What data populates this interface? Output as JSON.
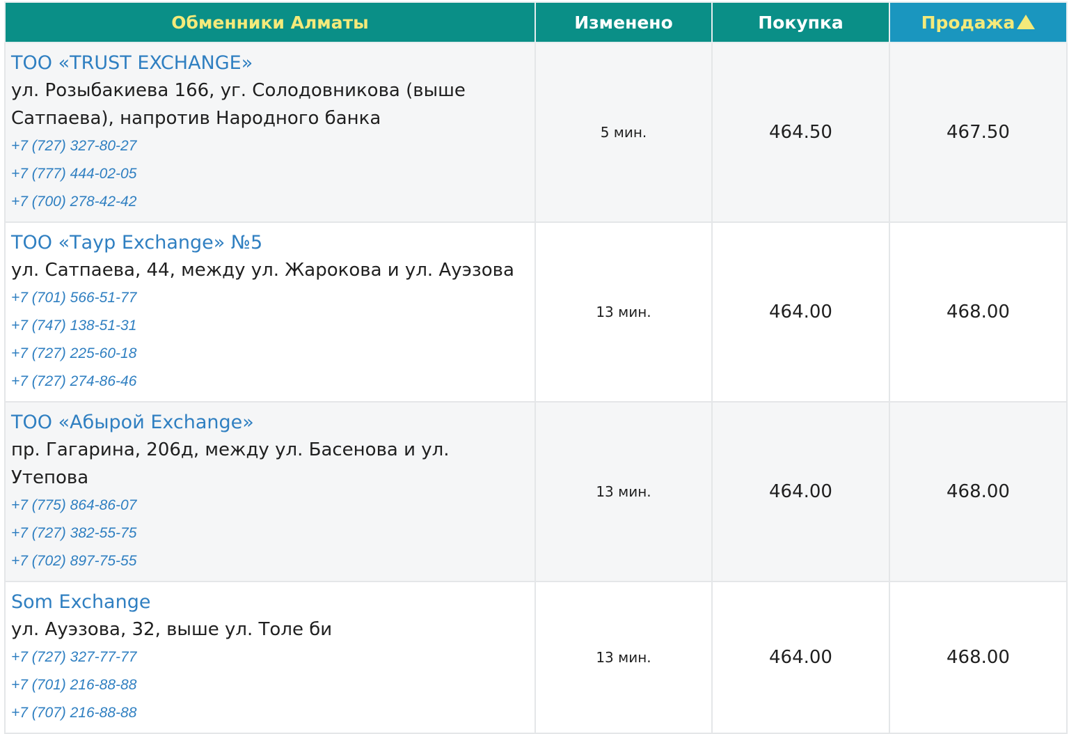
{
  "table": {
    "headers": {
      "name": "Обменники Алматы",
      "changed": "Изменено",
      "buy": "Покупка",
      "sell": "Продажа"
    },
    "sort": {
      "column": "sell",
      "direction": "ascending",
      "indicator": "triangle-up-icon"
    },
    "rows": [
      {
        "name": "ТОО «TRUST EXCHANGE»",
        "address": "ул. Розыбакиева 166, уг. Солодовникова (выше Сатпаева), напротив Народного банка",
        "phones": [
          "+7 (727) 327-80-27",
          "+7 (777) 444-02-05",
          "+7 (700) 278-42-42"
        ],
        "changed": "5 мин.",
        "buy": "464.50",
        "sell": "467.50"
      },
      {
        "name": "ТОО «Таур Exchange» №5",
        "address": "ул. Сатпаева, 44, между ул. Жарокова и ул. Ауэзова",
        "phones": [
          "+7 (701) 566-51-77",
          "+7 (747) 138-51-31",
          "+7 (727) 225-60-18",
          "+7 (727) 274-86-46"
        ],
        "changed": "13 мин.",
        "buy": "464.00",
        "sell": "468.00"
      },
      {
        "name": "ТОО «Абырой Exchange»",
        "address": "пр. Гагарина, 206д, между ул. Басенова и ул. Утепова",
        "phones": [
          "+7 (775) 864-86-07",
          "+7 (727) 382-55-75",
          "+7 (702) 897-75-55"
        ],
        "changed": "13 мин.",
        "buy": "464.00",
        "sell": "468.00"
      },
      {
        "name": "Som Exchange",
        "address": "ул. Ауэзова, 32, выше ул. Толе би",
        "phones": [
          "+7 (727) 327-77-77",
          "+7 (701) 216-88-88",
          "+7 (707) 216-88-88"
        ],
        "changed": "13 мин.",
        "buy": "464.00",
        "sell": "468.00"
      }
    ]
  },
  "colors": {
    "header_bg": "#0a8f87",
    "header_sorted_bg": "#1a96bf",
    "header_text_yellow": "#f4ea7a",
    "header_text_white": "#ffffff",
    "link_blue": "#2f7fc1",
    "row_stripe": "#f5f6f7"
  }
}
